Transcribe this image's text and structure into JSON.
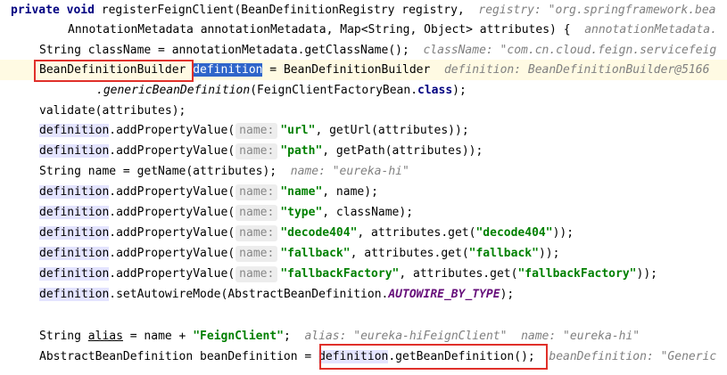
{
  "code": {
    "l1": {
      "kw1": "private void",
      "t1": " registerFeignClient(BeanDefinitionRegistry registry,  ",
      "hint": "registry: \"org.springframework.bea"
    },
    "l2": {
      "t1": "AnnotationMetadata annotationMetadata, Map<String, Object> attributes) {  ",
      "hint": "annotationMetadata."
    },
    "l3": {
      "t1": "String className = annotationMetadata.getClassName();  ",
      "hint": "className: \"com.cn.cloud.feign.servicefeig"
    },
    "l4": {
      "type": "BeanDefinitionBuilder",
      "var": "definition",
      "t1": " = BeanDefinitionBuilder  ",
      "hint": "definition: BeanDefinitionBuilder@5166"
    },
    "l5": {
      "method": ".genericBeanDefinition",
      "t1": "(FeignClientFactoryBean.",
      "kw": "class",
      "t2": ");"
    },
    "l6": {
      "t1": "validate(attributes);"
    },
    "l7": {
      "var": "definition",
      "t1": ".addPropertyValue(",
      "chip": "name:",
      "str": "\"url\"",
      "t2": ", getUrl(attributes));"
    },
    "l8": {
      "var": "definition",
      "t1": ".addPropertyValue(",
      "chip": "name:",
      "str": "\"path\"",
      "t2": ", getPath(attributes));"
    },
    "l9": {
      "t1": "String name = getName(attributes);  ",
      "hint": "name: \"eureka-hi\""
    },
    "l10": {
      "var": "definition",
      "t1": ".addPropertyValue(",
      "chip": "name:",
      "str": "\"name\"",
      "t2": ", name);"
    },
    "l11": {
      "var": "definition",
      "t1": ".addPropertyValue(",
      "chip": "name:",
      "str": "\"type\"",
      "t2": ", className);"
    },
    "l12": {
      "var": "definition",
      "t1": ".addPropertyValue(",
      "chip": "name:",
      "str": "\"decode404\"",
      "t2": ", attributes.get(",
      "str2": "\"decode404\"",
      "t3": "));"
    },
    "l13": {
      "var": "definition",
      "t1": ".addPropertyValue(",
      "chip": "name:",
      "str": "\"fallback\"",
      "t2": ", attributes.get(",
      "str2": "\"fallback\"",
      "t3": "));"
    },
    "l14": {
      "var": "definition",
      "t1": ".addPropertyValue(",
      "chip": "name:",
      "str": "\"fallbackFactory\"",
      "t2": ", attributes.get(",
      "str2": "\"fallbackFactory\"",
      "t3": "));"
    },
    "l15": {
      "var": "definition",
      "t1": ".setAutowireMode(AbstractBeanDefinition.",
      "field": "AUTOWIRE_BY_TYPE",
      "t2": ");"
    },
    "l16": {
      "t1": "String ",
      "var": "alias",
      "t2": " = name + ",
      "str": "\"FeignClient\"",
      "t3": ";  ",
      "hint": "alias: \"eureka-hiFeignClient\"  name: \"eureka-hi\""
    },
    "l17": {
      "t1": "AbstractBeanDefinition beanDefinition = ",
      "var": "definition",
      "t2": ".getBeanDefinition();  ",
      "hint": "beanDefinition: \"Generic"
    }
  }
}
